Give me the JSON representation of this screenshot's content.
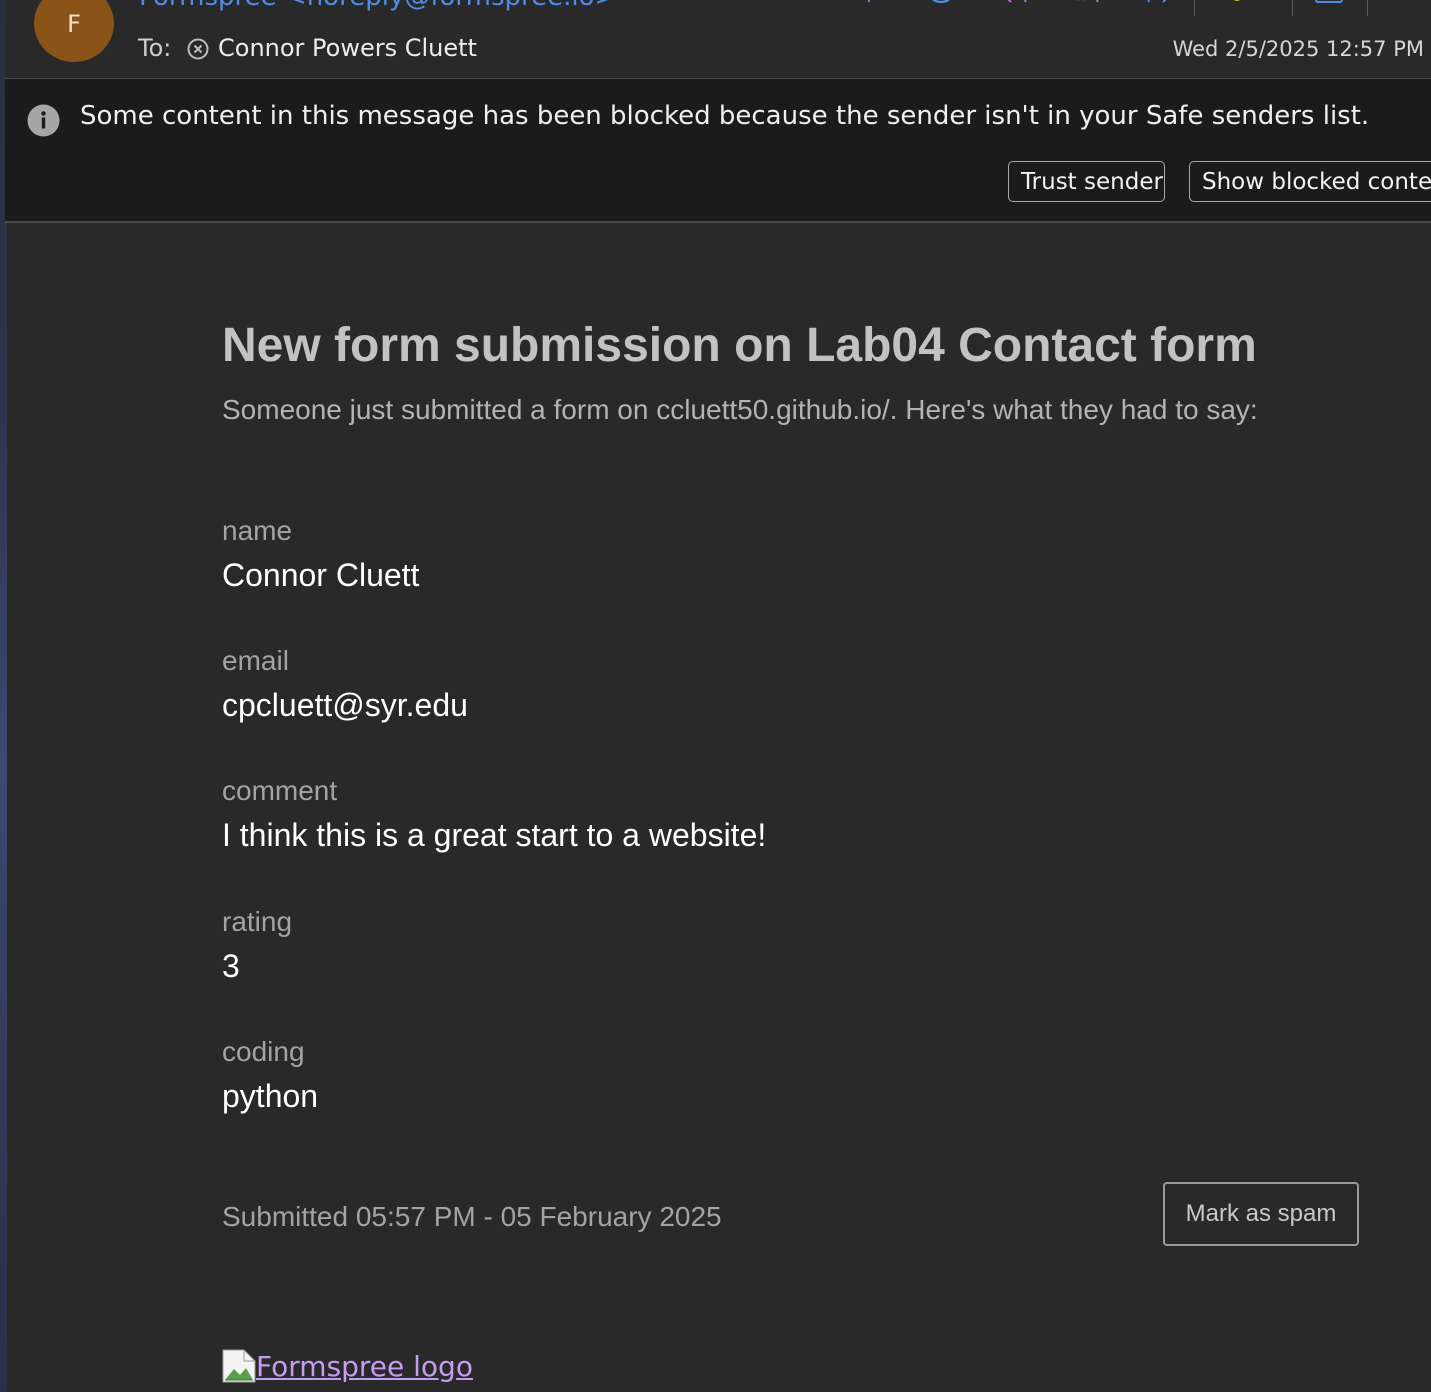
{
  "header": {
    "avatar_letter": "F",
    "sender": "Formspree <noreply@formspree.io>",
    "to_label": "To:",
    "recipient": "Connor Powers Cluett",
    "date": "Wed 2/5/2025 12:57 PM",
    "toolbar_icons": [
      "bulb-icon",
      "emoji-icon",
      "reply-icon",
      "reply-all-icon",
      "forward-icon",
      "rule-icon",
      "apps-icon"
    ],
    "accent_color": "#4f8ce9"
  },
  "banner": {
    "message": "Some content in this message has been blocked because the sender isn't in your Safe senders list.",
    "trust_button": "Trust sender",
    "show_blocked_button": "Show blocked content"
  },
  "email": {
    "title": "New form submission on Lab04 Contact form",
    "subtitle": "Someone just submitted a form on ccluett50.github.io/. Here's what they had to say:",
    "fields": [
      {
        "label": "name",
        "value": "Connor Cluett"
      },
      {
        "label": "email",
        "value": "cpcluett@syr.edu"
      },
      {
        "label": "comment",
        "value": "I think this is a great start to a website!"
      },
      {
        "label": "rating",
        "value": "3"
      },
      {
        "label": "coding",
        "value": "python"
      }
    ],
    "submitted": "Submitted 05:57 PM - 05 February 2025",
    "spam_button": "Mark as spam",
    "logo_alt": "Formspree logo"
  }
}
